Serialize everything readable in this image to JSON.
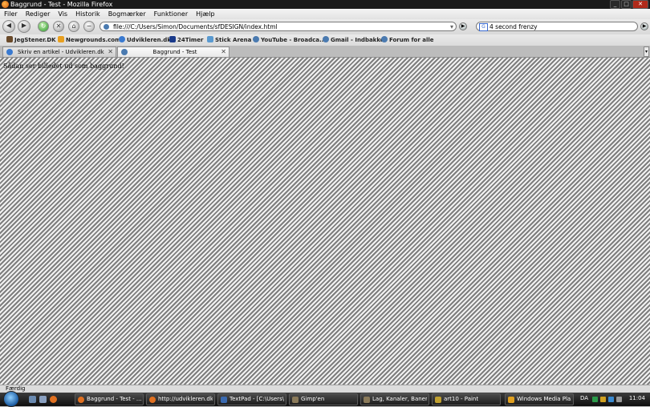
{
  "window": {
    "title": "Baggrund - Test - Mozilla Firefox",
    "controls": {
      "minimize": "_",
      "maximize": "□",
      "close": "✕"
    }
  },
  "menu": [
    "Filer",
    "Rediger",
    "Vis",
    "Historik",
    "Bogmærker",
    "Funktioner",
    "Hjælp"
  ],
  "navigation": {
    "url": "file:///C:/Users/Simon/Documents/sfDESIGN/index.html",
    "search_value": "4 second frenzy",
    "search_engine_icon": "google-icon"
  },
  "bookmarks": [
    {
      "label": "JegStener.DK",
      "icon": "favicon-icon"
    },
    {
      "label": "Newgrounds.com",
      "icon": "newgrounds-icon"
    },
    {
      "label": "Udvikleren.dk",
      "icon": "udvikleren-icon"
    },
    {
      "label": "24Timer",
      "icon": "24timer-icon"
    },
    {
      "label": "Stick Arena",
      "icon": "stick-arena-icon"
    },
    {
      "label": "YouTube - Broadca...",
      "icon": "globe-icon"
    },
    {
      "label": "Gmail - Indbakke",
      "icon": "globe-icon"
    },
    {
      "label": "Forum for alle",
      "icon": "globe-icon"
    }
  ],
  "tabs": [
    {
      "label": "Skriv en artikel - Udvikleren.dk - ...",
      "active": false
    },
    {
      "label": "Baggrund - Test",
      "active": true
    }
  ],
  "page": {
    "text": "Sådan ser billedet ud som baggrund!",
    "background_colors": [
      "#f2f2f2",
      "#7e7e7e"
    ]
  },
  "status": "Færdig",
  "taskbar": {
    "items": [
      {
        "label": "Baggrund - Test - ...",
        "icon": "firefox-icon"
      },
      {
        "label": "http://udvikleren.dk...",
        "icon": "firefox-icon"
      },
      {
        "label": "TextPad - [C:\\Users\\...",
        "icon": "textpad-icon"
      },
      {
        "label": "Gimp'en",
        "icon": "gimp-icon"
      },
      {
        "label": "Lag, Kanaler, Baner, ...",
        "icon": "gimp-icon"
      },
      {
        "label": "art10 - Paint",
        "icon": "paint-icon"
      },
      {
        "label": "Windows Media Pla...",
        "icon": "media-player-icon"
      }
    ],
    "language": "DA",
    "time": "11:04"
  }
}
